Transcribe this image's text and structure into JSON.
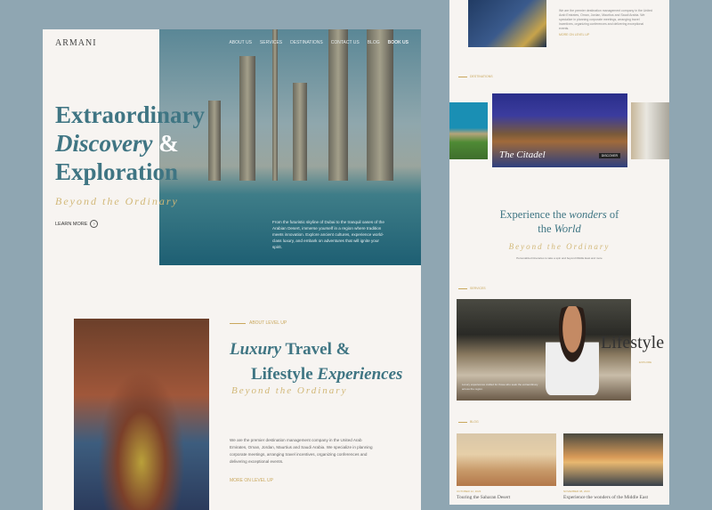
{
  "brand": "ARMANI",
  "nav": [
    "ABOUT US",
    "SERVICES",
    "DESTINATIONS",
    "CONTACT US",
    "BLOG"
  ],
  "nav_cta": "BOOK US",
  "hero": {
    "line1": "Extraordinary",
    "line2a": "Discovery",
    "line2b": " &",
    "line3": "Exploration",
    "tagline": "Beyond the Ordinary",
    "learn_more": "LEARN MORE",
    "text": "From the futuristic skyline of Dubai to the tranquil oases of the Arabian Desert, immerse yourself in a region where tradition meets innovation. Explore ancient cultures, experience world-class luxury, and embark on adventures that will ignite your spirit."
  },
  "about": {
    "label": "ABOUT LEVEL UP",
    "h_italic1": "Luxury",
    "h_rest1": " Travel &",
    "h_rest2": "Lifestyle ",
    "h_italic2": "Experiences",
    "tagline": "Beyond the Ordinary",
    "text": "We are the premier destination management company in the United Arab Emirates, Oman, Jordan, Maurtius and Saudi Arabia. We specialize in planning corporate meetings, arranging travel incentives, organizing conferences and delivering exceptional events.",
    "more": "MORE ON LEVEL UP"
  },
  "right": {
    "top_text": "We are the premier destination management company in the United Arab Emirates, Oman, Jordan, Maurtius and Saudi Arabia. We specialize in planning corporate meetings, arranging travel incentives, organizing conferences and delivering exceptional events.",
    "top_more": "MORE ON LEVEL UP",
    "destinations_label": "DESTINATIONS",
    "carousel_title": "The Citadel",
    "discover": "DISCOVER",
    "exp_a": "Experience the ",
    "exp_i": "wonders",
    "exp_b": " of",
    "exp_c": "the ",
    "exp_i2": "World",
    "tagline": "Beyond the Ordinary",
    "exp_sub": "Personalized itineraries to take a spin and beyond Middle East and more",
    "services_label": "SERVICES",
    "lifestyle": "Lifestyle",
    "lifestyle_more": "EXPLORE",
    "lifestyle_text": "Luxury experiences crafted for those who seek the extraordinary across the region.",
    "blog_label": "BLOG",
    "posts": [
      {
        "date": "OCTOBER 12, 2023",
        "title": "Touring the Saharan Desert"
      },
      {
        "date": "NOVEMBER 08, 2023",
        "title": "Experience the wonders of the Middle East"
      }
    ]
  }
}
